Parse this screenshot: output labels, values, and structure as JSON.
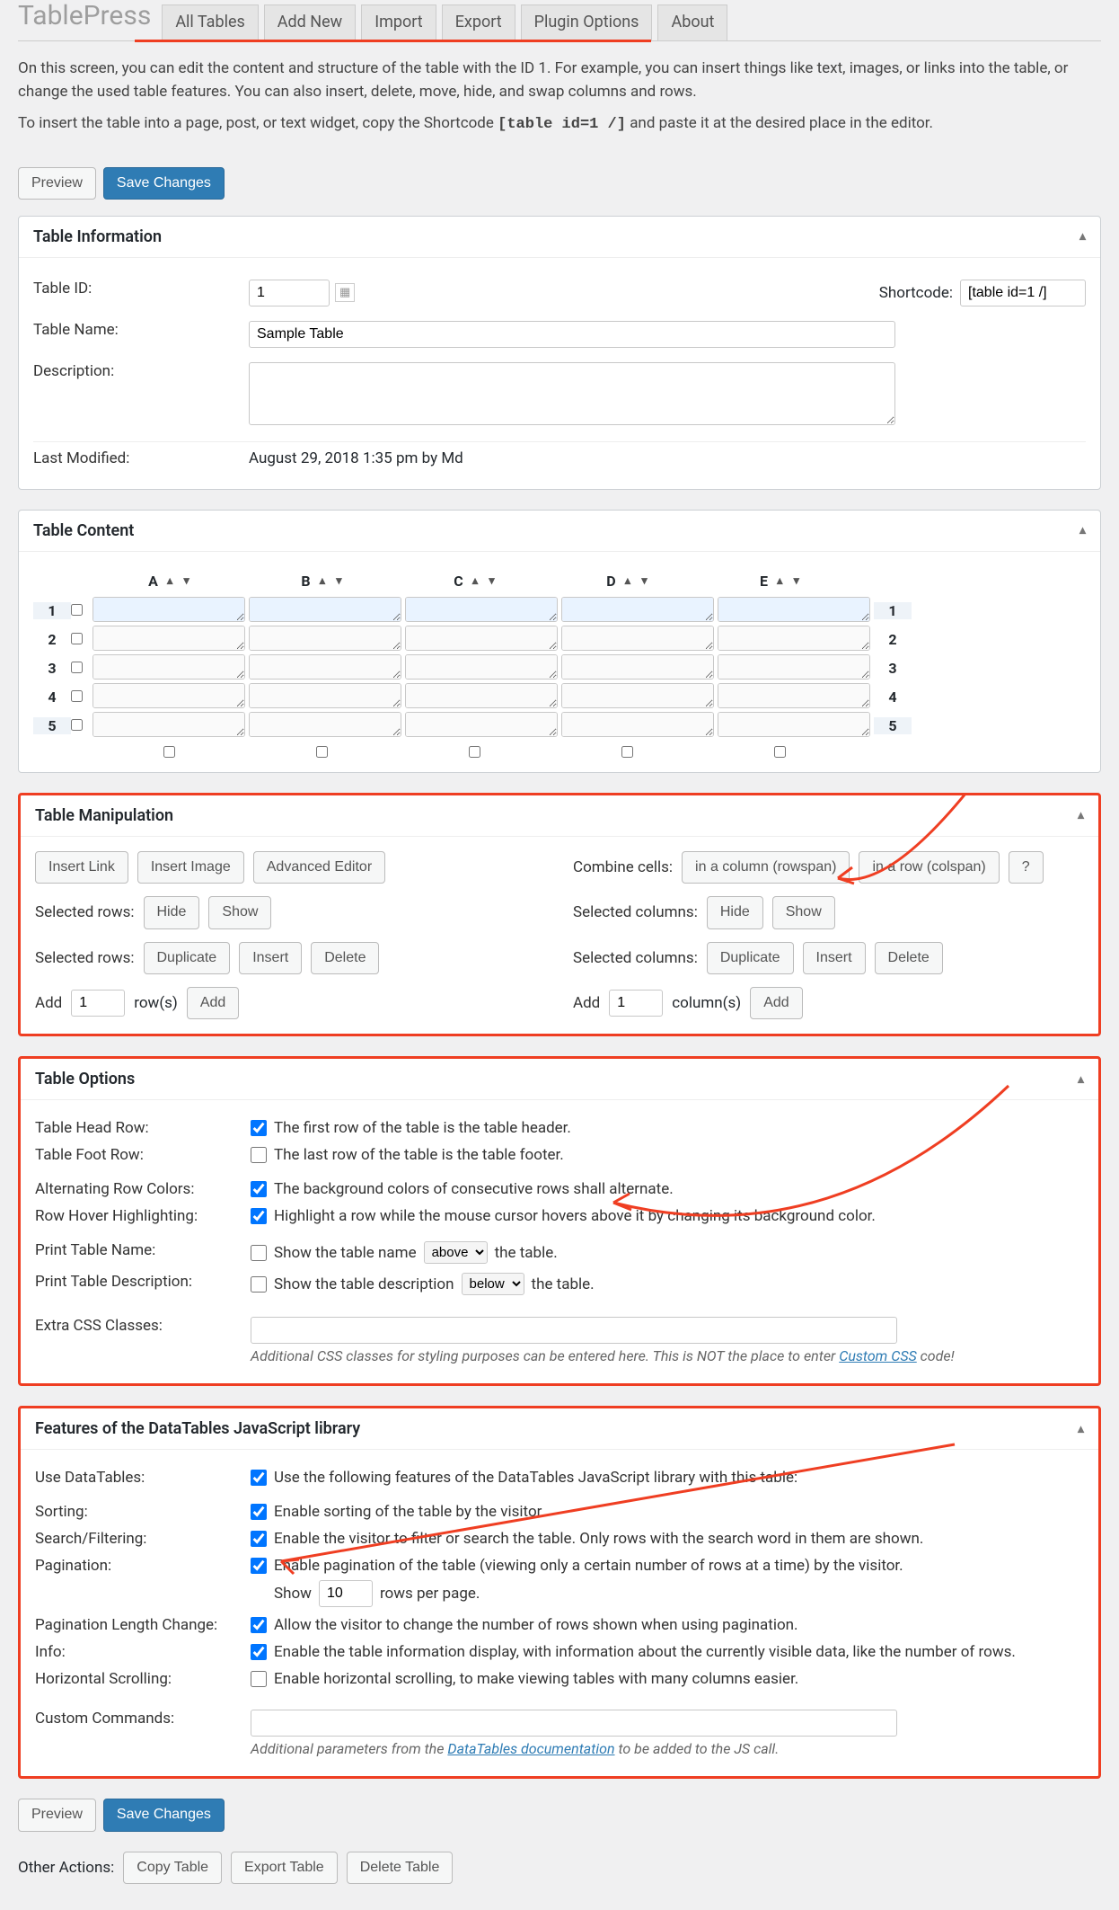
{
  "page_title": "TablePress",
  "tabs": [
    "All Tables",
    "Add New",
    "Import",
    "Export",
    "Plugin Options",
    "About"
  ],
  "intro": {
    "p1": "On this screen, you can edit the content and structure of the table with the ID 1. For example, you can insert things like text, images, or links into the table, or change the used table features. You can also insert, delete, move, hide, and swap columns and rows.",
    "p2a": "To insert the table into a page, post, or text widget, copy the Shortcode  ",
    "shortcode": "[table id=1 /]",
    "p2b": "  and paste it at the desired place in the editor."
  },
  "buttons": {
    "preview": "Preview",
    "save": "Save Changes"
  },
  "panels": {
    "info_title": "Table Information",
    "content_title": "Table Content",
    "manip_title": "Table Manipulation",
    "options_title": "Table Options",
    "dt_title": "Features of the DataTables JavaScript library"
  },
  "info": {
    "label_id": "Table ID:",
    "id_value": "1",
    "label_shortcode": "Shortcode:",
    "shortcode_value": "[table id=1 /]",
    "label_name": "Table Name:",
    "name_value": "Sample Table",
    "label_desc": "Description:",
    "desc_value": "",
    "label_modified": "Last Modified:",
    "modified_value": "August 29, 2018 1:35 pm by Md"
  },
  "content": {
    "cols": [
      "A",
      "B",
      "C",
      "D",
      "E"
    ],
    "rows": [
      "1",
      "2",
      "3",
      "4",
      "5"
    ]
  },
  "manip": {
    "insert_link": "Insert Link",
    "insert_image": "Insert Image",
    "adv_editor": "Advanced Editor",
    "combine_cells": "Combine cells:",
    "in_column": "in a column (rowspan)",
    "in_row": "in a row (colspan)",
    "q": "?",
    "sel_rows": "Selected rows:",
    "sel_cols": "Selected columns:",
    "hide": "Hide",
    "show": "Show",
    "duplicate": "Duplicate",
    "insert": "Insert",
    "delete": "Delete",
    "add": "Add",
    "rows_n": "1",
    "rows_label": "row(s)",
    "cols_n": "1",
    "cols_label": "column(s)",
    "add_btn": "Add"
  },
  "options": {
    "head_label": "Table Head Row:",
    "head_text": "The first row of the table is the table header.",
    "foot_label": "Table Foot Row:",
    "foot_text": "The last row of the table is the table footer.",
    "alt_label": "Alternating Row Colors:",
    "alt_text": "The background colors of consecutive rows shall alternate.",
    "hover_label": "Row Hover Highlighting:",
    "hover_text": "Highlight a row while the mouse cursor hovers above it by changing its background color.",
    "pname_label": "Print Table Name:",
    "pname_text_a": "Show the table name",
    "pname_sel": "above",
    "pname_text_b": "the table.",
    "pdesc_label": "Print Table Description:",
    "pdesc_text_a": "Show the table description",
    "pdesc_sel": "below",
    "pdesc_text_b": "the table.",
    "css_label": "Extra CSS Classes:",
    "css_value": "",
    "css_hint_a": "Additional CSS classes for styling purposes can be entered here. This is NOT the place to enter ",
    "css_link": "Custom CSS",
    "css_hint_b": " code!"
  },
  "dt": {
    "use_label": "Use DataTables:",
    "use_text": "Use the following features of the DataTables JavaScript library with this table:",
    "sort_label": "Sorting:",
    "sort_text": "Enable sorting of the table by the visitor.",
    "search_label": "Search/Filtering:",
    "search_text": "Enable the visitor to filter or search the table. Only rows with the search word in them are shown.",
    "page_label": "Pagination:",
    "page_text": "Enable pagination of the table (viewing only a certain number of rows at a time) by the visitor.",
    "show": "Show",
    "page_n": "10",
    "rpp": "rows per page.",
    "plc_label": "Pagination Length Change:",
    "plc_text": "Allow the visitor to change the number of rows shown when using pagination.",
    "info_label": "Info:",
    "info_text": "Enable the table information display, with information about the currently visible data, like the number of rows.",
    "hscroll_label": "Horizontal Scrolling:",
    "hscroll_text": "Enable horizontal scrolling, to make viewing tables with many columns easier.",
    "cmd_label": "Custom Commands:",
    "cmd_value": "",
    "cmd_hint_a": "Additional parameters from the ",
    "cmd_link": "DataTables documentation",
    "cmd_hint_b": " to be added to the JS call."
  },
  "other": {
    "label": "Other Actions:",
    "copy": "Copy Table",
    "export": "Export Table",
    "del": "Delete Table"
  }
}
